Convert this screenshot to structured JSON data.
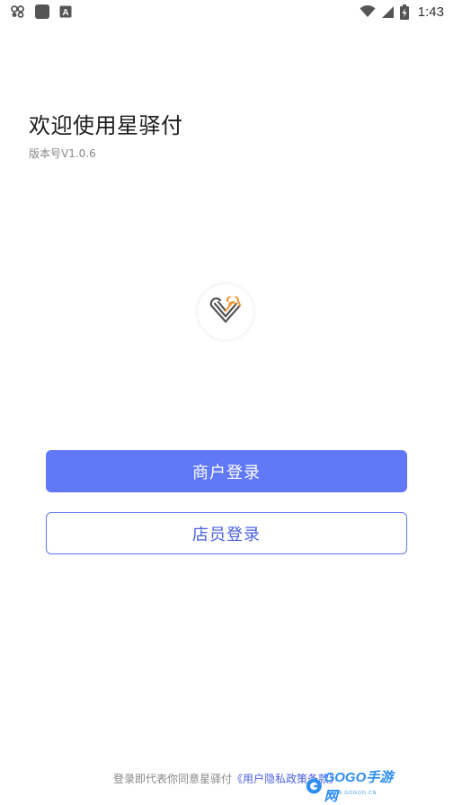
{
  "status_bar": {
    "time": "1:43",
    "left_icons": [
      "notification-app-icon",
      "app-square-icon",
      "text-a-icon"
    ],
    "right_icons": [
      "wifi-icon",
      "signal-icon",
      "battery-charging-icon"
    ]
  },
  "welcome": {
    "title": "欢迎使用星驿付",
    "version": "版本号V1.0.6"
  },
  "logo": {
    "icon": "xingyifu-logo-icon",
    "colors": [
      "#555555",
      "#f29a3a"
    ]
  },
  "buttons": {
    "merchant_login": "商户登录",
    "staff_login": "店员登录"
  },
  "agreement": {
    "prefix": "登录即代表你同意星驿付",
    "link": "《用户隐私政策条款》"
  },
  "watermark": {
    "text": "GOGO手游网",
    "sub": "WWW.GOGOO.CN"
  },
  "colors": {
    "primary": "#6179f7",
    "link": "#4a5fe0"
  }
}
